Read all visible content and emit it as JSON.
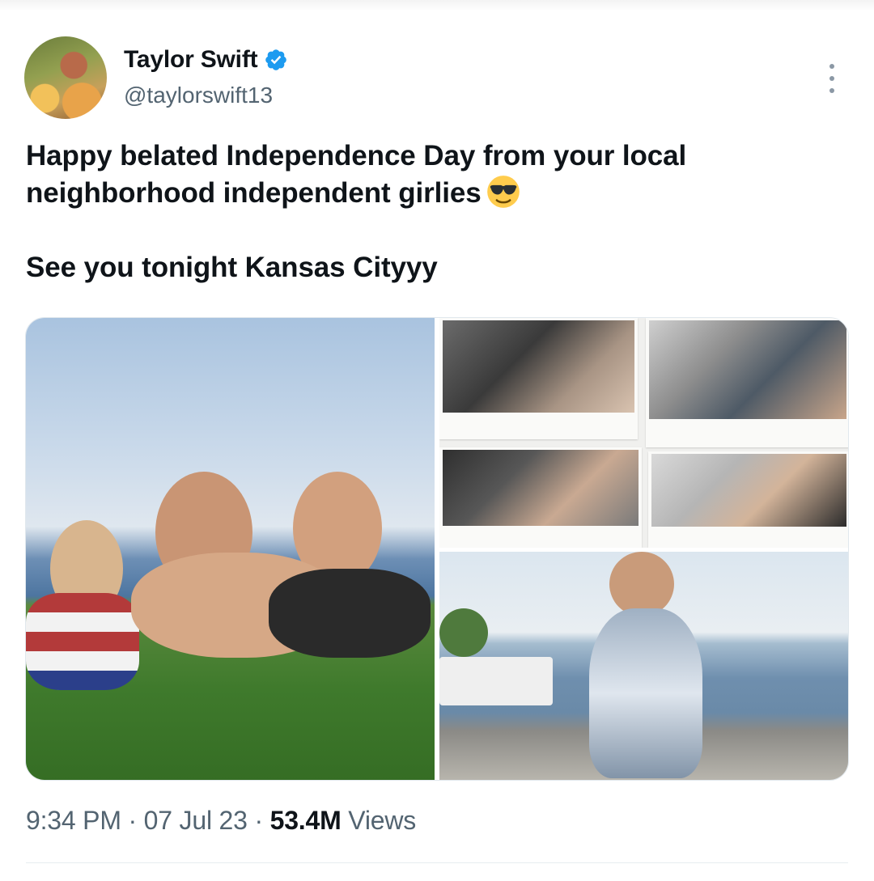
{
  "author": {
    "display_name": "Taylor Swift",
    "handle": "@taylorswift13",
    "verified": true
  },
  "tweet": {
    "line1": "Happy belated Independence Day from your local",
    "line2": "neighborhood independent girlies",
    "line2_emoji": "smiling-face-with-sunglasses-icon",
    "line3": "See you tonight Kansas Cityyy"
  },
  "meta": {
    "time": "9:34 PM",
    "sep1": "·",
    "date": "07 Jul 23",
    "sep2": "·",
    "views_count": "53.4M",
    "views_label": "Views"
  },
  "colors": {
    "verified": "#1d9bf0",
    "secondary_text": "#536471",
    "primary_text": "#0f1419"
  }
}
